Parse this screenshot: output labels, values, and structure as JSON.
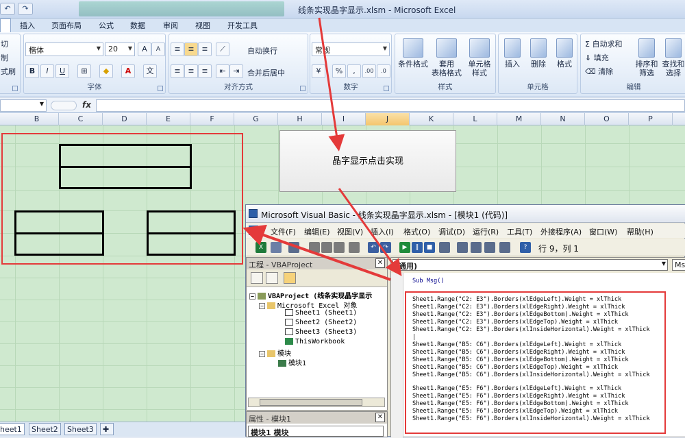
{
  "window": {
    "title": "线条实现晶字显示.xlsm - Microsoft Excel"
  },
  "ribbon_tabs": [
    {
      "label": "插入"
    },
    {
      "label": "页面布局"
    },
    {
      "label": "公式"
    },
    {
      "label": "数据"
    },
    {
      "label": "审阅"
    },
    {
      "label": "视图"
    },
    {
      "label": "开发工具"
    }
  ],
  "clipboard": {
    "cut": "切",
    "copy": "制",
    "format_painter": "式刷"
  },
  "font": {
    "name": "楷体",
    "size": "20",
    "group_label": "字体"
  },
  "alignment": {
    "wrap": "自动换行",
    "merge": "合并后居中",
    "group_label": "对齐方式"
  },
  "number": {
    "format": "常规",
    "group_label": "数字",
    "percent": "%",
    "comma": ",",
    "inc": ".00",
    "dec": ".0"
  },
  "styles": {
    "conditional": "条件格式",
    "table_line1": "套用",
    "table_line2": "表格格式",
    "cell_line1": "单元格",
    "cell_line2": "样式",
    "group_label": "样式"
  },
  "cells": {
    "insert": "插入",
    "delete": "删除",
    "format": "格式",
    "group_label": "单元格"
  },
  "editing": {
    "autosum": "自动求和",
    "fill": "填充",
    "clear": "清除",
    "sort_line1": "排序和",
    "sort_line2": "筛选",
    "find_line1": "查找和",
    "find_line2": "选择",
    "group_label": "编辑"
  },
  "formula_bar": {
    "fx": "fx"
  },
  "columns": [
    "B",
    "C",
    "D",
    "E",
    "F",
    "G",
    "H",
    "I",
    "J",
    "K",
    "L",
    "M",
    "N",
    "O",
    "P"
  ],
  "selected_column": "J",
  "macro_button": {
    "label": "晶字显示点击实现"
  },
  "sheet_tabs": [
    {
      "label": "heet1"
    },
    {
      "label": "Sheet2"
    },
    {
      "label": "Sheet3"
    }
  ],
  "vba": {
    "title": "Microsoft Visual Basic - 线条实现晶字显示.xlsm - [模块1 (代码)]",
    "menu": [
      "文件(F)",
      "编辑(E)",
      "视图(V)",
      "插入(I)",
      "格式(O)",
      "调试(D)",
      "运行(R)",
      "工具(T)",
      "外接程序(A)",
      "窗口(W)",
      "帮助(H)"
    ],
    "cursor_pos": "行 9，列 1",
    "project_title": "工程 - VBAProject",
    "tree": {
      "root": "VBAProject (线条实现晶字显示",
      "excel_objects": "Microsoft Excel 对象",
      "sheet1": "Sheet1 (Sheet1)",
      "sheet2": "Sheet2 (Sheet2)",
      "sheet3": "Sheet3 (Sheet3)",
      "workbook": "ThisWorkbook",
      "modules": "模块",
      "module1": "模块1"
    },
    "props_title": "属性 - 模块1",
    "props_value": "模块1 模块",
    "code_object": "(通用)",
    "code_proc": "Ms",
    "code_lines": [
      "Sub Msg()",
      "",
      "Sheet1.Range(\"C2: E3\").Borders(xlEdgeLeft).Weight = xlThick",
      "Sheet1.Range(\"C2: E3\").Borders(xlEdgeRight).Weight = xlThick",
      "Sheet1.Range(\"C2: E3\").Borders(xlEdgeBottom).Weight = xlThick",
      "Sheet1.Range(\"C2: E3\").Borders(xlEdgeTop).Weight = xlThick",
      "Sheet1.Range(\"C2: E3\").Borders(xlInsideHorizontal).Weight = xlThick",
      "|",
      "Sheet1.Range(\"B5: C6\").Borders(xlEdgeLeft).Weight = xlThick",
      "Sheet1.Range(\"B5: C6\").Borders(xlEdgeRight).Weight = xlThick",
      "Sheet1.Range(\"B5: C6\").Borders(xlEdgeBottom).Weight = xlThick",
      "Sheet1.Range(\"B5: C6\").Borders(xlEdgeTop).Weight = xlThick",
      "Sheet1.Range(\"B5: C6\").Borders(xlInsideHorizontal).Weight = xlThick",
      "",
      "Sheet1.Range(\"E5: F6\").Borders(xlEdgeLeft).Weight = xlThick",
      "Sheet1.Range(\"E5: F6\").Borders(xlEdgeRight).Weight = xlThick",
      "Sheet1.Range(\"E5: F6\").Borders(xlEdgeBottom).Weight = xlThick",
      "Sheet1.Range(\"E5: F6\").Borders(xlEdgeTop).Weight = xlThick",
      "Sheet1.Range(\"E5: F6\").Borders(xlInsideHorizontal).Weight = xlThick"
    ]
  },
  "annotation_color": "#e43a3a"
}
